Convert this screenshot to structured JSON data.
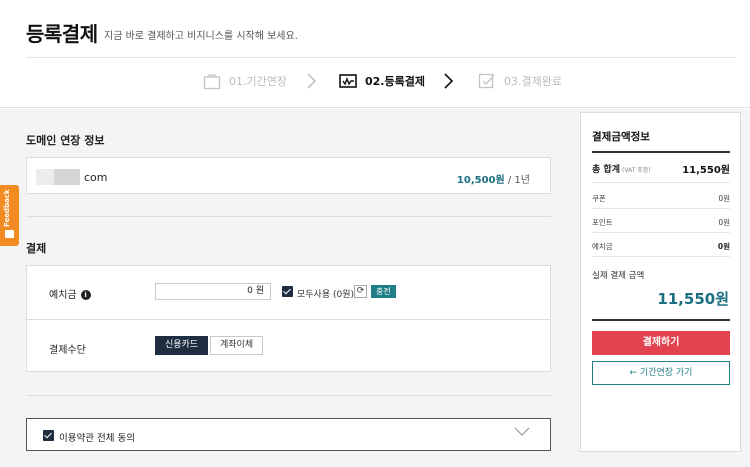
{
  "header": {
    "title": "등록결제",
    "subtitle": "지금 바로 결제하고 비지니스를 시작해 보세요."
  },
  "steps": [
    {
      "label": "01.기간연장",
      "icon": "bag-icon",
      "state": "done"
    },
    {
      "label": "02.등록결제",
      "icon": "card-payment-icon",
      "state": "active"
    },
    {
      "label": "03.결제완료",
      "icon": "check-icon",
      "state": "pending"
    }
  ],
  "domain_section": {
    "title": "도메인 연장 정보",
    "domain_suffix": "com",
    "price": "10,500원",
    "period": " / 1년"
  },
  "payment_section": {
    "title": "결제",
    "deposit_label": "예치금",
    "deposit_value": "0 원",
    "use_all_label": "모두사용 (0원)",
    "use_all_checked": true,
    "refresh_icon": "refresh-icon",
    "charge_label": "충전",
    "method_label": "결제수단",
    "methods": [
      "신용카드",
      "계좌이체"
    ],
    "selected_method": "신용카드"
  },
  "terms": {
    "label": "이용약관 전체 동의",
    "checked": true
  },
  "summary": {
    "title": "결제금액정보",
    "total_label": "총 합계",
    "total_note": "(VAT 포함)",
    "total_value": "11,550원",
    "rows": [
      {
        "label": "쿠폰",
        "value": "0원"
      },
      {
        "label": "포인트",
        "value": "0원"
      },
      {
        "label": "예치금",
        "value": "0원"
      }
    ],
    "real_label": "실제 결제 금액",
    "real_amount": "11,550원",
    "pay_button": "결제하기",
    "back_button": "←  기간연장 가기"
  },
  "feedback": {
    "label": "Feedback"
  },
  "colors": {
    "accent_teal": "#1b6f80",
    "navy": "#1e2d40",
    "pay_red": "#e3434f",
    "feedback_orange": "#f28b22"
  }
}
